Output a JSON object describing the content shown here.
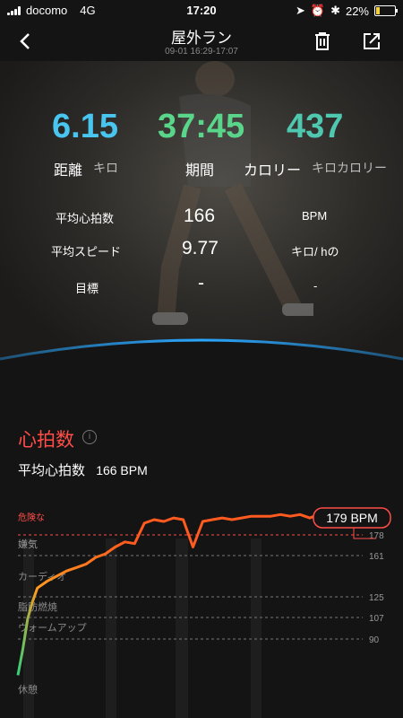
{
  "status_bar": {
    "carrier": "docomo",
    "network": "4G",
    "time": "17:20",
    "battery": "22%",
    "battery_level": 0.22
  },
  "nav": {
    "title": "屋外ラン",
    "subtitle": "09-01 16:29-17:07"
  },
  "colors": {
    "distance": "#49c6f0",
    "duration": "#59d68a",
    "calories": "#4ec9b0",
    "danger": "#ff4d47",
    "line": "#ff5a1f"
  },
  "summary": {
    "distance": {
      "value": "6.15",
      "label": "距離",
      "unit": "キロ"
    },
    "duration": {
      "value": "37:45",
      "label": "期間"
    },
    "calories": {
      "value": "437",
      "label": "カロリー",
      "unit": "キロカロリー"
    }
  },
  "stats": [
    {
      "label": "平均心拍数",
      "value": "166",
      "unit": "BPM"
    },
    {
      "label": "平均スピード",
      "value": "9.77",
      "unit": "キロ/ hの"
    },
    {
      "label": "目標",
      "value": "-",
      "unit": "-"
    }
  ],
  "heart_rate": {
    "title": "心拍数",
    "info_icon": "i",
    "avg_label": "平均心拍数",
    "avg_value": "166 BPM",
    "max_badge": "179 BPM"
  },
  "chart_data": {
    "type": "line",
    "zones": [
      {
        "label": "危険な",
        "threshold": "178"
      },
      {
        "label": "嫌気",
        "threshold": "161"
      },
      {
        "label": "カーディオ",
        "threshold": ""
      },
      {
        "label": "脂肪燃焼",
        "threshold": "125"
      },
      {
        "label": "ウォームアップ",
        "threshold": "107"
      },
      {
        "label": "",
        "threshold": "90"
      },
      {
        "label": "休憩",
        "threshold": ""
      }
    ],
    "series": [
      {
        "x": [
          0,
          0.5,
          1,
          1.5,
          2,
          3,
          4,
          5,
          6,
          7,
          8,
          9,
          10,
          11,
          12,
          13,
          14,
          15,
          16,
          17,
          18,
          19,
          20,
          21,
          22,
          23,
          24,
          25,
          26,
          27,
          28,
          29,
          30,
          31,
          32,
          33,
          34,
          35,
          36,
          37,
          37.75
        ],
        "values": [
          85,
          100,
          118,
          128,
          136,
          140,
          143,
          146,
          148,
          150,
          154,
          156,
          160,
          163,
          162,
          174,
          176,
          175,
          177,
          176,
          160,
          175,
          176,
          177,
          176,
          177,
          178,
          178,
          178,
          179,
          178,
          179,
          177,
          179,
          178,
          179,
          177,
          178,
          179,
          178,
          176
        ]
      }
    ],
    "xlim": [
      0,
      37.75
    ],
    "ylim": [
      60,
      186
    ]
  }
}
